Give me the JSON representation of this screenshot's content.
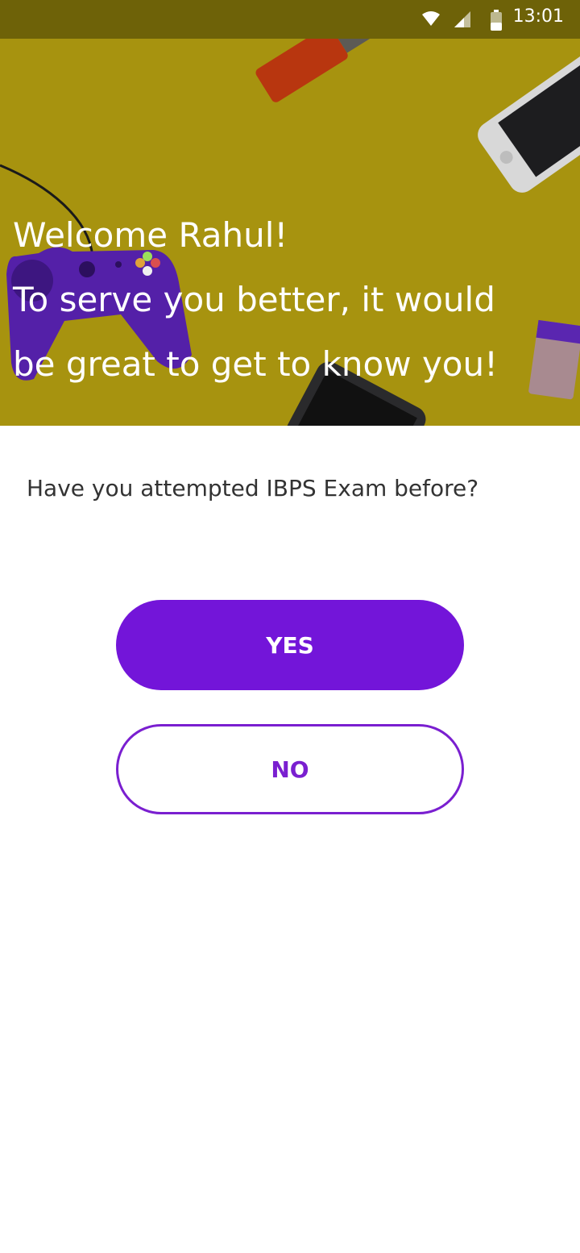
{
  "status_bar": {
    "time": "13:01",
    "icons": [
      "wifi-icon",
      "cellular-signal-icon",
      "battery-icon"
    ]
  },
  "hero": {
    "line1": "Welcome Rahul!",
    "line2": "To serve you better, it would",
    "line3": "be great to get to know you!",
    "background_color": "#a7930f",
    "illustrations": [
      "usb-drive-icon",
      "smartphone-icon",
      "game-controller-icon",
      "eraser-icon"
    ]
  },
  "question": {
    "text": "Have you attempted IBPS Exam before?"
  },
  "buttons": {
    "yes_label": "YES",
    "no_label": "NO"
  },
  "colors": {
    "accent": "#7315d9",
    "status_bar": "#6e6208"
  }
}
